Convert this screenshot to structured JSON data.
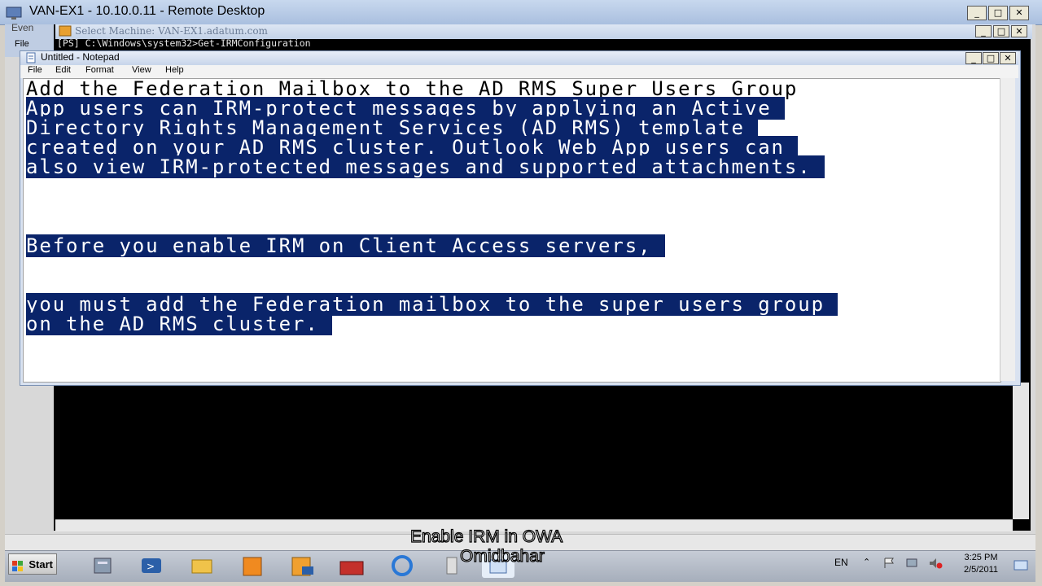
{
  "remote_desktop": {
    "title": "VAN-EX1 - 10.10.0.11 - Remote Desktop",
    "min": "_",
    "max": "□",
    "close": "✕"
  },
  "background_window": {
    "label": "Even",
    "menu_file": "File"
  },
  "powershell": {
    "title": "Select Machine: VAN-EX1.adatum.com",
    "command": "[PS] C:\\Windows\\system32>Get-IRMConfiguration"
  },
  "notepad": {
    "title": "Untitled - Notepad",
    "menu": [
      "File",
      "Edit",
      "Format",
      "View",
      "Help"
    ],
    "lines": [
      {
        "text": "Add the Federation Mailbox to the AD RMS Super Users Group",
        "selected": false
      },
      {
        "text": "App users can IRM-protect messages by applying an Active ",
        "selected": true
      },
      {
        "text": "Directory Rights Management Services (AD RMS) template ",
        "selected": true
      },
      {
        "text": "created on your AD RMS cluster. Outlook Web App users can ",
        "selected": true
      },
      {
        "text": "also view IRM-protected messages and supported attachments. ",
        "selected": true
      },
      {
        "text": "",
        "selected": false
      },
      {
        "text": "",
        "selected": false
      },
      {
        "text": "",
        "selected": false
      },
      {
        "text": "Before you enable IRM on Client Access servers, ",
        "selected": true
      },
      {
        "text": "",
        "selected": false
      },
      {
        "text": "",
        "selected": false
      },
      {
        "text": "you must add the Federation mailbox to the super users group ",
        "selected": true
      },
      {
        "text": "on the AD RMS cluster. ",
        "selected": true
      }
    ]
  },
  "taskbar": {
    "start_label": "Start",
    "language": "EN",
    "time": "3:25 PM",
    "date": "2/5/2011",
    "apps": [
      "server-manager-icon",
      "powershell-icon",
      "explorer-icon",
      "exchange-console-icon",
      "exchange-shell-icon",
      "toolbox-icon",
      "internet-explorer-icon",
      "notepad-icon",
      "notepad-active-icon"
    ]
  },
  "captions": {
    "line1": "Enable IRM in OWA",
    "line2": "Omidbahar"
  }
}
